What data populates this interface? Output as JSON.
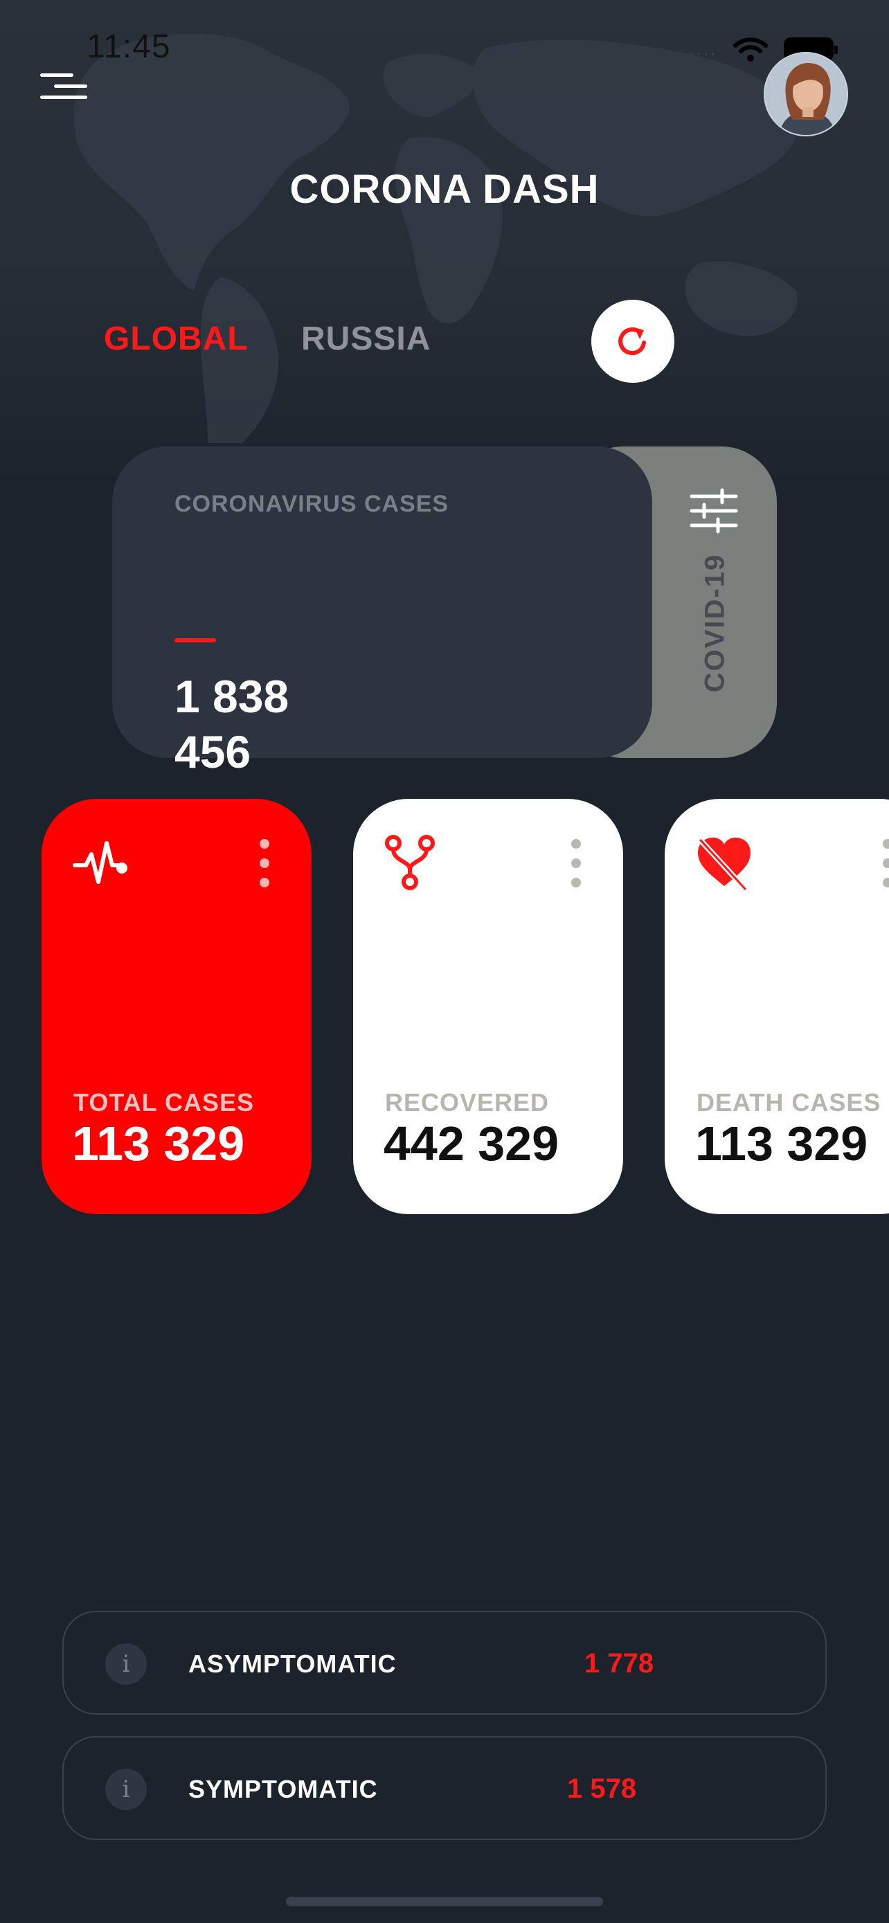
{
  "status_bar": {
    "time": "11:45",
    "signal": "...."
  },
  "header": {
    "app_title": "CORONA DASH"
  },
  "tabs": [
    {
      "label": "GLOBAL",
      "active": true
    },
    {
      "label": "RUSSIA",
      "active": false
    }
  ],
  "hero_card": {
    "label": "CORONAVIRUS CASES",
    "value": "1 838 456",
    "side_label": "COVID-19"
  },
  "stat_cards": [
    {
      "label": "TOTAL CASES",
      "value": "113 329",
      "icon": "heartbeat-icon"
    },
    {
      "label": "RECOVERED",
      "value": "442 329",
      "icon": "branch-icon"
    },
    {
      "label": "DEATH CASES",
      "value": "113 329",
      "icon": "broken-heart-icon"
    }
  ],
  "info_rows": [
    {
      "label": "ASYMPTOMATIC",
      "value": "1 778",
      "icon_glyph": "i"
    },
    {
      "label": "SYMPTOMATIC",
      "value": "1 578",
      "icon_glyph": "i"
    }
  ],
  "colors": {
    "background": "#1d232c",
    "accent_red": "#ff0000",
    "card_white": "#ffffff",
    "hero_card": "#2d3440",
    "hero_side": "#7a817d"
  }
}
